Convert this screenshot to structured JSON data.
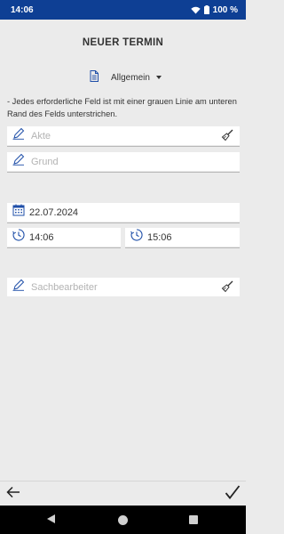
{
  "status_bar": {
    "time": "14:06",
    "battery": "100 %"
  },
  "page": {
    "title": "NEUER TERMIN",
    "category": "Allgemein",
    "info_text": "- Jedes erforderliche Feld ist mit einer grauen Linie am unteren Rand des Felds unterstrichen."
  },
  "fields": {
    "akte_placeholder": "Akte",
    "grund_placeholder": "Grund",
    "date_value": "22.07.2024",
    "start_time": "14:06",
    "end_time": "15:06",
    "sachbearbeiter_placeholder": "Sachbearbeiter"
  },
  "colors": {
    "status_bar": "#0e3f94",
    "accent_icon": "#1f4fa8",
    "background": "#ebebeb"
  }
}
